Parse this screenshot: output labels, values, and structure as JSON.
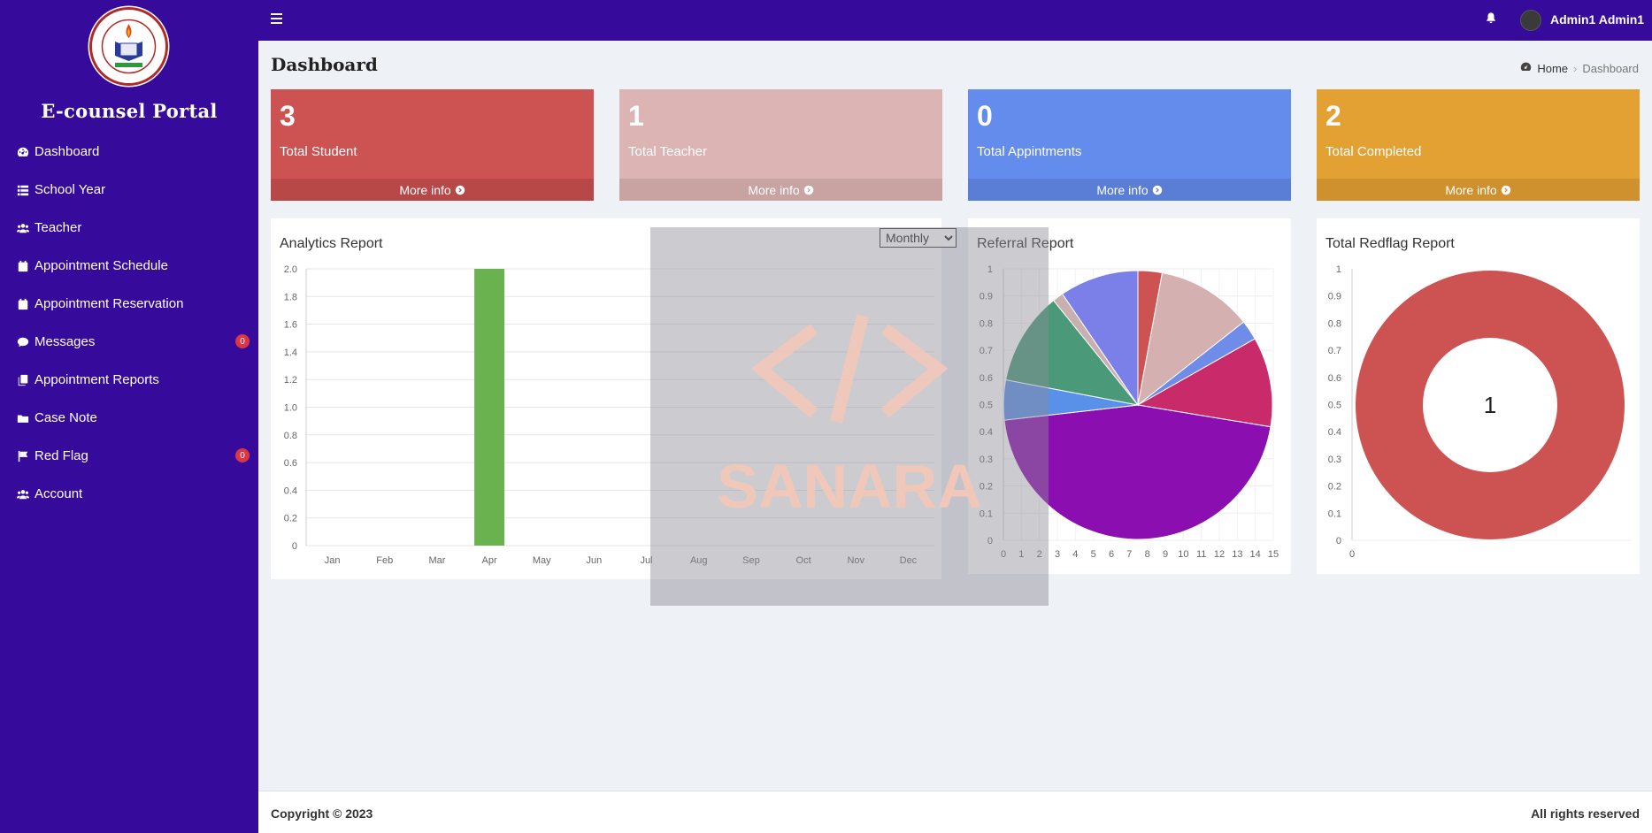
{
  "sidebar": {
    "brand": "E-counsel Portal",
    "logo_text": "BALANACAN NATIONAL HIGH SCHOOL · MOGPOG MARINDUQUE",
    "items": [
      {
        "label": "Dashboard",
        "icon": "dashboard-icon"
      },
      {
        "label": "School Year",
        "icon": "list-icon"
      },
      {
        "label": "Teacher",
        "icon": "users-icon"
      },
      {
        "label": "Appointment Schedule",
        "icon": "calendar-icon"
      },
      {
        "label": "Appointment Reservation",
        "icon": "calendar-icon"
      },
      {
        "label": "Messages",
        "icon": "comment-icon",
        "badge": "0"
      },
      {
        "label": "Appointment Reports",
        "icon": "copy-icon"
      },
      {
        "label": "Case Note",
        "icon": "folder-icon"
      },
      {
        "label": "Red Flag",
        "icon": "flag-icon",
        "badge": "0"
      },
      {
        "label": "Account",
        "icon": "users-icon"
      }
    ]
  },
  "topbar": {
    "user_name": "Admin1 Admin1"
  },
  "header": {
    "title": "Dashboard",
    "breadcrumb_home": "Home",
    "breadcrumb_current": "Dashboard"
  },
  "cards": [
    {
      "value": "3",
      "label": "Total Student",
      "more": "More info",
      "color": "#cd5353",
      "footer_color": "#b84848"
    },
    {
      "value": "1",
      "label": "Total Teacher",
      "more": "More info",
      "color": "#dcb4b4",
      "footer_color": "#c9a2a2"
    },
    {
      "value": "0",
      "label": "Total Appintments",
      "more": "More info",
      "color": "#648ced",
      "footer_color": "#5a7ed6"
    },
    {
      "value": "2",
      "label": "Total Completed",
      "more": "More info",
      "color": "#e3a133",
      "footer_color": "#cf912d"
    }
  ],
  "panels": {
    "analytics_title": "Analytics Report",
    "filter_value": "Monthly",
    "referral_title": "Referral Report",
    "redflag_title": "Total Redflag Report"
  },
  "chart_data": [
    {
      "type": "bar",
      "title": "Analytics Report",
      "categories": [
        "Jan",
        "Feb",
        "Mar",
        "Apr",
        "May",
        "Jun",
        "Jul",
        "Aug",
        "Sep",
        "Oct",
        "Nov",
        "Dec"
      ],
      "values": [
        0,
        0,
        0,
        2,
        0,
        0,
        0,
        0,
        0,
        0,
        0,
        0
      ],
      "ylim": [
        0,
        2.0
      ],
      "yticks": [
        "0",
        "0.2",
        "0.4",
        "0.6",
        "0.8",
        "1.0",
        "1.2",
        "1.4",
        "1.6",
        "1.8",
        "2.0"
      ],
      "bar_color": "#6ab150",
      "grid": true
    },
    {
      "type": "pie",
      "title": "Referral Report",
      "xticks": [
        "0",
        "1",
        "2",
        "3",
        "4",
        "5",
        "6",
        "7",
        "8",
        "9",
        "10",
        "11",
        "12",
        "13",
        "14",
        "15"
      ],
      "yticks": [
        "0",
        "0.1",
        "0.2",
        "0.3",
        "0.4",
        "0.5",
        "0.6",
        "0.7",
        "0.8",
        "0.9",
        "1"
      ],
      "slices": [
        {
          "value": 2.9,
          "color": "#cd5353"
        },
        {
          "value": 11.5,
          "color": "#d4b0b0"
        },
        {
          "value": 2.4,
          "color": "#6f8de8"
        },
        {
          "value": 10.8,
          "color": "#c92a6a"
        },
        {
          "value": 45.6,
          "color": "#8a0eb0"
        },
        {
          "value": 4.8,
          "color": "#5a91e8"
        },
        {
          "value": 11.2,
          "color": "#4a9a7a"
        },
        {
          "value": 1.3,
          "color": "#c9b0b0"
        },
        {
          "value": 9.5,
          "color": "#7a80e8"
        }
      ]
    },
    {
      "type": "pie",
      "title": "Total Redflag Report",
      "center_label": "1",
      "xticks": [
        "0"
      ],
      "yticks": [
        "0",
        "0.1",
        "0.2",
        "0.3",
        "0.4",
        "0.5",
        "0.6",
        "0.7",
        "0.8",
        "0.9",
        "1"
      ],
      "slices": [
        {
          "value": 1,
          "color": "#cd5353"
        }
      ]
    }
  ],
  "watermark": {
    "text": "SANARA",
    "color": "#f5c8b8"
  },
  "footer": {
    "copyright": "Copyright © 2023",
    "rights": "All rights reserved"
  }
}
